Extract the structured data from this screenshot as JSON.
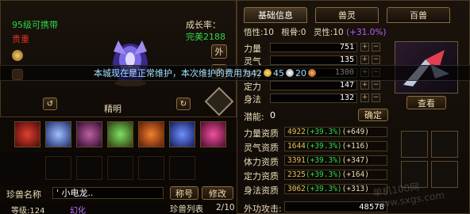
{
  "left_panel": {
    "level_text": "95级可携带",
    "rarity": "贵重",
    "growth_label": "成长率：",
    "growth_value": "完美2188",
    "wai_button": "外",
    "nei_button": "内",
    "pet_type": "精明"
  },
  "tabs": [
    "基础信息",
    "兽灵",
    "百兽"
  ],
  "stats_row": {
    "wuxing_label": "悟性:10",
    "gengu_label": "根骨:0",
    "lingxing_label": "灵性:10",
    "lingxing_bonus": "(+31.0%)"
  },
  "attributes": [
    {
      "label": "力量",
      "value": "751"
    },
    {
      "label": "灵气",
      "value": "135"
    },
    {
      "label": "体力",
      "value": "1300"
    },
    {
      "label": "定力",
      "value": "147"
    },
    {
      "label": "身法",
      "value": "132"
    }
  ],
  "potential": {
    "label": "潜能:",
    "value": "0",
    "confirm": "确定"
  },
  "view_button": "查看",
  "aptitudes": [
    {
      "label": "力量资质",
      "base": "4922",
      "pct": "(+39.3%)",
      "bonus": "(+649)"
    },
    {
      "label": "灵气资质",
      "base": "1644",
      "pct": "(+39.3%)",
      "bonus": "(+116)"
    },
    {
      "label": "体力资质",
      "base": "3391",
      "pct": "(+39.3%)",
      "bonus": "(+347)"
    },
    {
      "label": "定力资质",
      "base": "2325",
      "pct": "(+39.3%)",
      "bonus": "(+164)"
    },
    {
      "label": "身法资质",
      "base": "3062",
      "pct": "(+39.3%)",
      "bonus": "(+313)"
    }
  ],
  "outer_attack": {
    "label": "外功攻击:",
    "value": "48578"
  },
  "pet_name": {
    "label": "珍兽名称",
    "value": "' 小电龙.."
  },
  "rename_button": "称号",
  "modify_button": "修改",
  "level_info": "等级:124",
  "transform_text": "幻化",
  "pet_list": {
    "label": "珍兽列表",
    "value": "2/10"
  },
  "notice": {
    "text": "本城现在是正常维护，本次维护的费用为",
    "gold": "42",
    "silver": "45",
    "copper": "20"
  },
  "watermark": "单机100网 www.sxgs.com",
  "colors": {
    "green": "#2fd64a",
    "red": "#e03020",
    "purple": "#c070ff",
    "gold": "#f2d23c",
    "notice": "#9fe0ff"
  }
}
